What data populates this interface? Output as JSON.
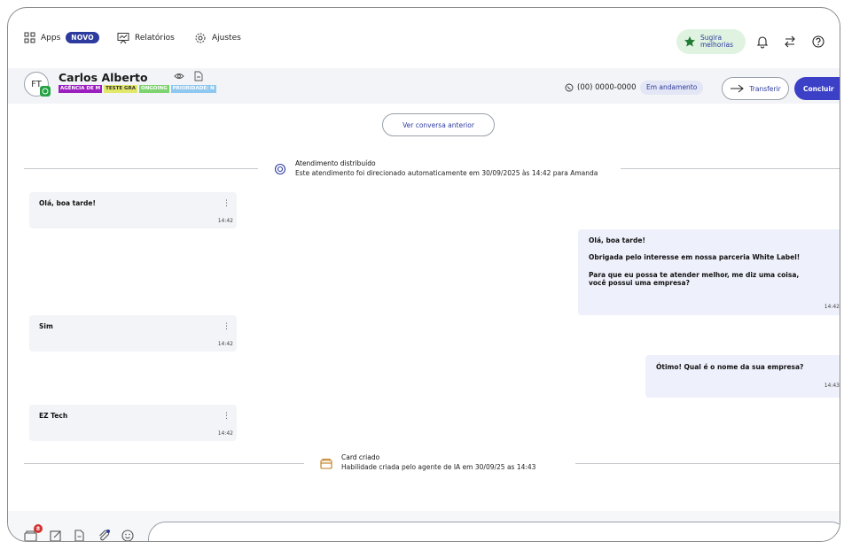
{
  "nav": {
    "apps_label": "Apps",
    "apps_badge": "NOVO",
    "reports_label": "Relatórios",
    "settings_label": "Ajustes",
    "suggest_line1": "Sugira",
    "suggest_line2": "melhorias"
  },
  "contact": {
    "initials": "FT",
    "name": "Carlos Alberto",
    "tags": [
      {
        "label": "AGÊNCIA DE M",
        "bg": "#9b1fbf",
        "fg": "#ffffff"
      },
      {
        "label": "TESTE GRA",
        "bg": "#e2e86a",
        "fg": "#333333"
      },
      {
        "label": "ONGOING",
        "bg": "#7dd36f",
        "fg": "#ffffff"
      },
      {
        "label": "PRIORIDADE: N",
        "bg": "#8ec8f0",
        "fg": "#ffffff"
      }
    ],
    "phone": "(00) 0000-0000",
    "status": "Em andamento",
    "transfer_label": "Transferir",
    "conclude_label": "Concluir"
  },
  "chat": {
    "previous_label": "Ver conversa anterior",
    "event_distributed": {
      "title": "Atendimento distribuído",
      "description": "Este atendimento foi direcionado automaticamente em 30/09/2025 às 14:42 para Amanda"
    },
    "incoming": [
      {
        "text": "Olá, boa tarde!",
        "time": "14:42"
      },
      {
        "text": "Sim",
        "time": "14:42"
      },
      {
        "text": "EZ Tech",
        "time": "14:42"
      }
    ],
    "outgoing": [
      {
        "lines": [
          "Olá, boa tarde!",
          "Obrigada pelo interesse em nossa parceria White Label!",
          "Para que eu possa te atender melhor, me diz uma coisa,",
          "você possui uma empresa?"
        ],
        "time": "14:42"
      },
      {
        "lines": [
          "Ótimo! Qual é o nome da sua empresa?"
        ],
        "time": "14:43"
      }
    ],
    "event_card": {
      "title": "Card criado",
      "description": "Habilidade criada pelo agente de IA em 30/09/25 as 14:43"
    }
  },
  "composer": {
    "notification_count": "8"
  },
  "colors": {
    "brand": "#2d3a9e",
    "primary_button": "#3b40c7",
    "whatsapp": "#25a244"
  }
}
